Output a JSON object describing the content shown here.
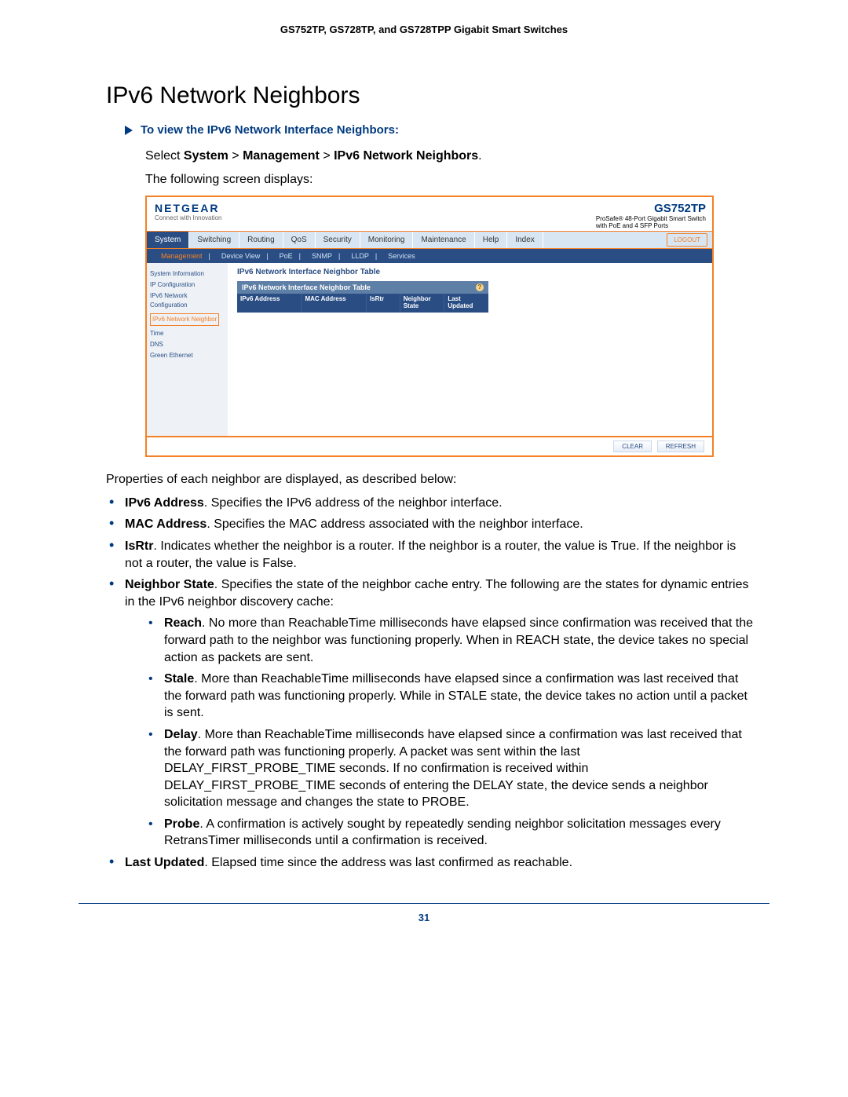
{
  "doc": {
    "header": "GS752TP, GS728TP, and GS728TPP Gigabit Smart Switches",
    "page_number": "31",
    "h1": "IPv6 Network Neighbors",
    "proc_title": "To view the IPv6 Network Interface Neighbors:",
    "select_prefix": "Select ",
    "select_path_1": "System",
    "select_path_2": "Management",
    "select_path_3": "IPv6 Network Neighbors",
    "sep": " > ",
    "following": "The following screen displays:",
    "props_intro": "Properties of each neighbor are displayed, as described below:"
  },
  "screenshot": {
    "logo": "NETGEAR",
    "logo_sub": "Connect with Innovation",
    "model": "GS752TP",
    "model_sub1": "ProSafe® 48-Port Gigabit Smart Switch",
    "model_sub2": "with PoE and 4 SFP Ports",
    "logout": "LOGOUT",
    "tabs": [
      "System",
      "Switching",
      "Routing",
      "QoS",
      "Security",
      "Monitoring",
      "Maintenance",
      "Help",
      "Index"
    ],
    "active_tab": 0,
    "subtabs": [
      "Management",
      "Device View",
      "PoE",
      "SNMP",
      "LLDP",
      "Services"
    ],
    "active_subtab": 0,
    "sidebar": [
      {
        "label": "System Information",
        "style": ""
      },
      {
        "label": "IP Configuration",
        "style": ""
      },
      {
        "label": "IPv6 Network Configuration",
        "style": ""
      },
      {
        "label": "IPv6 Network Neighbor",
        "style": "box"
      },
      {
        "label": "Time",
        "style": ""
      },
      {
        "label": "DNS",
        "style": ""
      },
      {
        "label": "Green Ethernet",
        "style": ""
      }
    ],
    "main_title": "IPv6 Network Interface Neighbor Table",
    "panel_title": "IPv6 Network Interface Neighbor Table",
    "columns": [
      "IPv6 Address",
      "MAC Address",
      "IsRtr",
      "Neighbor State",
      "Last Updated"
    ],
    "buttons": [
      "CLEAR",
      "REFRESH"
    ]
  },
  "bullets": {
    "b1_term": "IPv6 Address",
    "b1_rest": ". Specifies the IPv6 address of the neighbor interface.",
    "b2_term": "MAC Address",
    "b2_rest": ". Specifies the MAC address associated with the neighbor interface.",
    "b3_term": "IsRtr",
    "b3_rest": ". Indicates whether the neighbor is a router. If the neighbor is a router, the value is True. If the neighbor is not a router, the value is False.",
    "b4_term": "Neighbor State",
    "b4_rest": ". Specifies the state of the neighbor cache entry. The following are the states for dynamic entries in the IPv6 neighbor discovery cache:",
    "s1_term": "Reach",
    "s1_rest": ". No more than ReachableTime milliseconds have elapsed since confirmation was received that the forward path to the neighbor was functioning properly. When in REACH state, the device takes no special action as packets are sent.",
    "s2_term": "Stale",
    "s2_rest": ". More than ReachableTime milliseconds have elapsed since a confirmation was last received that the forward path was functioning properly. While in STALE state, the device takes no action until a packet is sent.",
    "s3_term": "Delay",
    "s3_rest": ". More than ReachableTime milliseconds have elapsed since a confirmation was last received that the forward path was functioning properly. A packet was sent within the last DELAY_FIRST_PROBE_TIME seconds. If no confirmation is received within DELAY_FIRST_PROBE_TIME seconds of entering the DELAY state, the device sends a neighbor solicitation message and changes the state to PROBE.",
    "s4_term": "Probe",
    "s4_rest": ". A confirmation is actively sought by repeatedly sending neighbor solicitation messages every RetransTimer milliseconds until a confirmation is received.",
    "b5_term": "Last Updated",
    "b5_rest": ". Elapsed time since the address was last confirmed as reachable."
  }
}
